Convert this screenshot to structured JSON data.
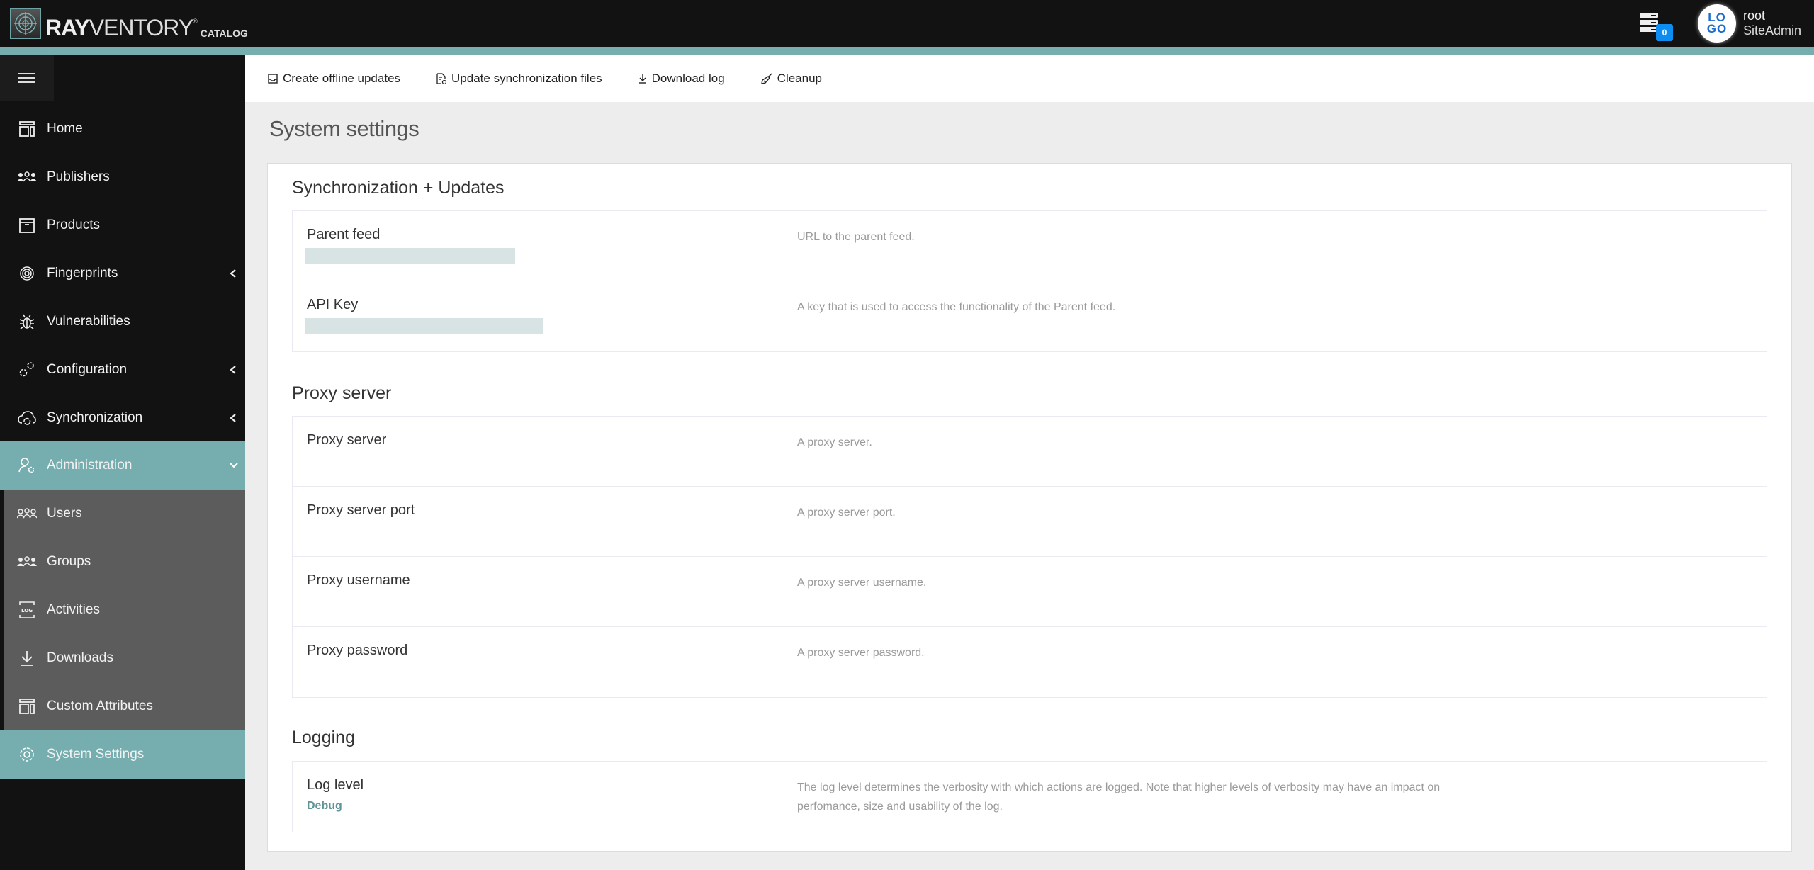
{
  "header": {
    "brand_bold": "RAY",
    "brand_light": "VENTORY",
    "brand_reg": "®",
    "brand_sub": "CATALOG",
    "server_badge_count": "0",
    "avatar_line1": "LO",
    "avatar_line2": "GO",
    "user_name": "root",
    "user_role": "SiteAdmin"
  },
  "colors": {
    "accent": "#76aeb0",
    "sidebar_bg": "#121212",
    "submenu_bg": "#5c5c5c",
    "badge": "#0d8df0",
    "value_link": "#5f9496"
  },
  "sidebar": {
    "items": [
      {
        "label": "Home",
        "icon": "home-layout-icon"
      },
      {
        "label": "Publishers",
        "icon": "people-icon"
      },
      {
        "label": "Products",
        "icon": "box-icon"
      },
      {
        "label": "Fingerprints",
        "icon": "fingerprint-icon",
        "expandable": true
      },
      {
        "label": "Vulnerabilities",
        "icon": "bug-icon"
      },
      {
        "label": "Configuration",
        "icon": "gears-icon",
        "expandable": true
      },
      {
        "label": "Synchronization",
        "icon": "cloud-sync-icon",
        "expandable": true
      },
      {
        "label": "Administration",
        "icon": "user-gear-icon",
        "expanded": true
      },
      {
        "label": "Users",
        "icon": "users-icon"
      },
      {
        "label": "Groups",
        "icon": "group-icon"
      },
      {
        "label": "Activities",
        "icon": "log-icon"
      },
      {
        "label": "Downloads",
        "icon": "download-icon"
      },
      {
        "label": "Custom Attributes",
        "icon": "layout-icon"
      },
      {
        "label": "System Settings",
        "icon": "gear-icon",
        "active": true
      }
    ]
  },
  "toolbar": {
    "buttons": [
      {
        "label": "Create offline updates",
        "icon": "inbox-icon"
      },
      {
        "label": "Update synchronization files",
        "icon": "file-sync-icon"
      },
      {
        "label": "Download log",
        "icon": "download-icon"
      },
      {
        "label": "Cleanup",
        "icon": "broom-icon"
      }
    ]
  },
  "page": {
    "title": "System settings"
  },
  "sections": [
    {
      "title": "Synchronization + Updates",
      "rows": [
        {
          "label": "Parent feed",
          "value": "[redacted]",
          "description": "URL to the parent feed."
        },
        {
          "label": "API Key",
          "value": "[redacted]",
          "description": "A key that is used to access the functionality of the Parent feed."
        }
      ]
    },
    {
      "title": "Proxy server",
      "rows": [
        {
          "label": "Proxy server",
          "value": "",
          "description": "A proxy server."
        },
        {
          "label": "Proxy server port",
          "value": "",
          "description": "A proxy server port."
        },
        {
          "label": "Proxy username",
          "value": "",
          "description": "A proxy server username."
        },
        {
          "label": "Proxy password",
          "value": "",
          "description": "A proxy server password."
        }
      ]
    },
    {
      "title": "Logging",
      "rows": [
        {
          "label": "Log level",
          "value": "Debug",
          "description": "The log level determines the verbosity with which actions are logged. Note that higher levels of verbosity may have an impact on perfomance, size and usability of the log."
        }
      ]
    }
  ]
}
